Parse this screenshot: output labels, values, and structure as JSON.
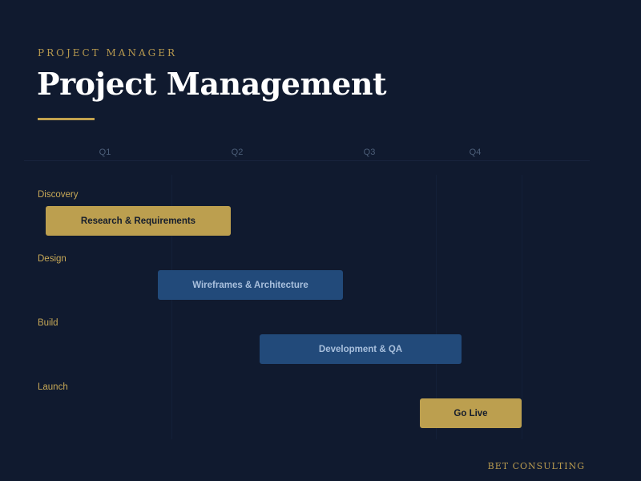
{
  "header": {
    "eyebrow": "PROJECT MANAGER",
    "title": "Project Management"
  },
  "footer": {
    "brand": "BET CONSULTING"
  },
  "colors": {
    "background": "#101a2f",
    "gold": "#bc9f4f",
    "blue": "#224a7a",
    "title_text": "#ffffff",
    "axis_text": "#4c5e78"
  },
  "chart_data": {
    "type": "gantt",
    "axis": {
      "labels": [
        "Q1",
        "Q2",
        "Q3",
        "Q4"
      ],
      "range": [
        0,
        4
      ]
    },
    "phases": [
      {
        "label": "Discovery",
        "task": "Research & Requirements",
        "start": 0.0,
        "end": 1.4,
        "style": "gold"
      },
      {
        "label": "Design",
        "task": "Wireframes & Architecture",
        "start": 0.85,
        "end": 2.25,
        "style": "blue"
      },
      {
        "label": "Build",
        "task": "Development & QA",
        "start": 1.62,
        "end": 3.15,
        "style": "blue"
      },
      {
        "label": "Launch",
        "task": "Go Live",
        "start": 2.83,
        "end": 3.6,
        "style": "gold"
      }
    ]
  }
}
